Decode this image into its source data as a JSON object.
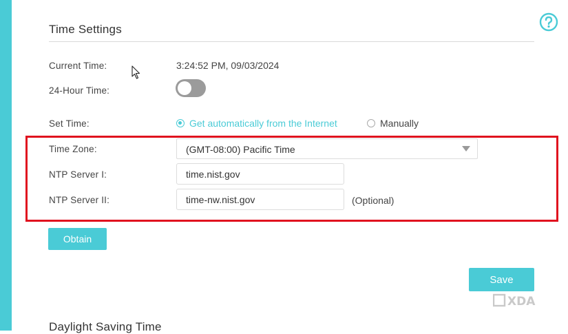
{
  "page": {
    "title": "Time Settings",
    "next_section_title": "Daylight Saving Time"
  },
  "fields": {
    "current_time": {
      "label": "Current Time:",
      "value": "3:24:52 PM, 09/03/2024"
    },
    "hour24": {
      "label": "24-Hour Time:",
      "enabled": false
    },
    "set_time": {
      "label": "Set Time:",
      "options": [
        {
          "label": "Get automatically from the Internet",
          "selected": true
        },
        {
          "label": "Manually",
          "selected": false
        }
      ]
    },
    "time_zone": {
      "label": "Time Zone:",
      "value": "(GMT-08:00) Pacific Time"
    },
    "ntp1": {
      "label": "NTP Server I:",
      "value": "time.nist.gov"
    },
    "ntp2": {
      "label": "NTP Server II:",
      "value": "time-nw.nist.gov",
      "hint": "(Optional)"
    }
  },
  "buttons": {
    "obtain": "Obtain",
    "save": "Save"
  },
  "watermark": {
    "text": "XDA"
  },
  "icons": {
    "help": "help-circle-icon",
    "cursor": "mouse-pointer-icon",
    "dropdown": "caret-down-icon"
  },
  "colors": {
    "accent": "#4acbd6",
    "highlight_border": "#e0101e",
    "toggle_off": "#9b9b9b",
    "text": "#444444"
  }
}
